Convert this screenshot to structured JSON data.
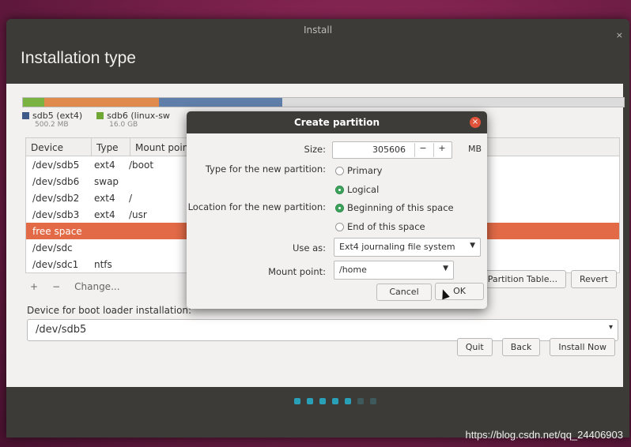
{
  "window": {
    "title": "Install",
    "close": "×",
    "heading": "Installation type"
  },
  "diskbar": {
    "segments": [
      {
        "color": "#7ab342",
        "fraction": 0.036
      },
      {
        "color": "#e08a4e",
        "fraction": 0.19
      },
      {
        "color": "#5f7ea9",
        "fraction": 0.205
      },
      {
        "color": "#dcdcdc",
        "fraction": 0.569
      }
    ]
  },
  "legend": [
    {
      "label": "sdb5 (ext4)",
      "size": "500.2 MB",
      "color": "#3d5a89"
    },
    {
      "label": "sdb6 (linux-sw",
      "size": "16.0 GB",
      "color": "#6ea733"
    }
  ],
  "table": {
    "headers": [
      "Device",
      "Type",
      "Mount point"
    ],
    "rows": [
      {
        "device": "/dev/sdb5",
        "type": "ext4",
        "mount": "/boot"
      },
      {
        "device": "/dev/sdb6",
        "type": "swap",
        "mount": ""
      },
      {
        "device": "/dev/sdb2",
        "type": "ext4",
        "mount": "/"
      },
      {
        "device": "/dev/sdb3",
        "type": "ext4",
        "mount": "/usr"
      },
      {
        "device": "free space",
        "type": "",
        "mount": ""
      },
      {
        "device": "/dev/sdc",
        "type": "",
        "mount": ""
      },
      {
        "device": "/dev/sdc1",
        "type": "ntfs",
        "mount": ""
      }
    ]
  },
  "tools": {
    "add": "+",
    "remove": "−",
    "change": "Change..."
  },
  "partition_buttons": {
    "new_table": "New Partition Table...",
    "revert": "Revert"
  },
  "boot": {
    "label": "Device for boot loader installation:",
    "value": "/dev/sdb5",
    "arrow": "▾"
  },
  "actions": {
    "quit": "Quit",
    "back": "Back",
    "install": "Install Now"
  },
  "steps": {
    "done": 5,
    "total": 7
  },
  "dialog": {
    "title": "Create partition",
    "close": "×",
    "size_label": "Size:",
    "size_value": "305606",
    "size_minus": "−",
    "size_plus": "+",
    "size_unit": "MB",
    "type_label": "Type for the new partition:",
    "type_primary": "Primary",
    "type_logical": "Logical",
    "location_label": "Location for the new partition:",
    "loc_begin": "Beginning of this space",
    "loc_end": "End of this space",
    "use_as_label": "Use as:",
    "use_as_value": "Ext4 journaling file system",
    "mount_label": "Mount point:",
    "mount_value": "/home",
    "cancel": "Cancel",
    "ok": "OK"
  },
  "watermark": "https://blog.csdn.net/qq_24406903"
}
